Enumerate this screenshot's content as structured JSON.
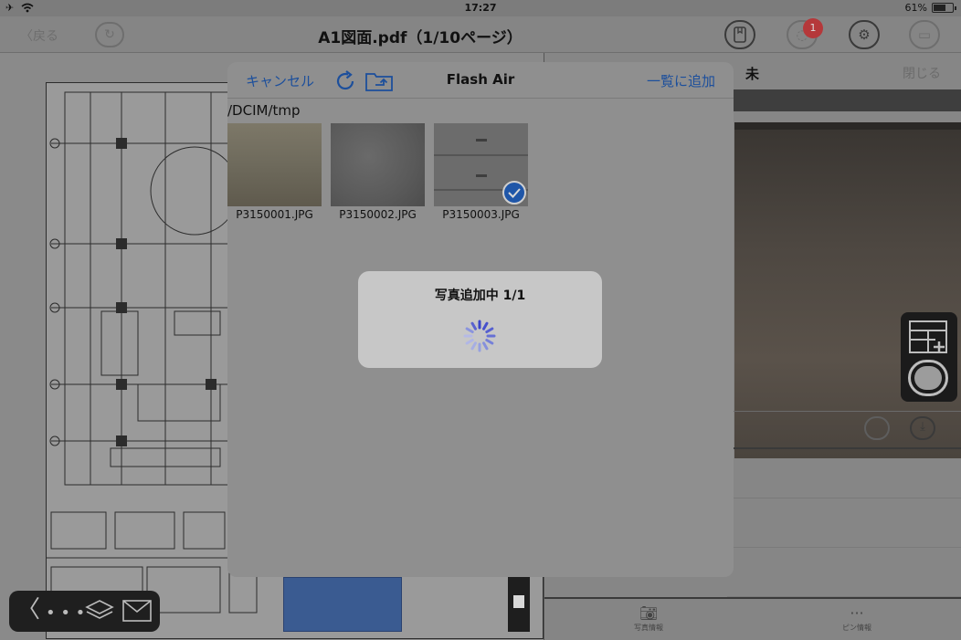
{
  "status_bar": {
    "time": "17:27",
    "battery": "61%"
  },
  "nav": {
    "back_label": "〈戻る",
    "title": "A1図面.pdf（1/10ページ）",
    "notification_count": "1"
  },
  "right_panel": {
    "title": "未",
    "close_label": "閉じる",
    "tabs": [
      {
        "label": "写真情報"
      },
      {
        "label": "ピン情報"
      }
    ]
  },
  "modal": {
    "cancel_label": "キャンセル",
    "title": "Flash Air",
    "add_label": "一覧に追加",
    "path": "/DCIM/tmp",
    "files": [
      {
        "name": "P3150001.JPG",
        "selected": false
      },
      {
        "name": "P3150002.JPG",
        "selected": false
      },
      {
        "name": "P3150003.JPG",
        "selected": true
      }
    ]
  },
  "progress_alert": {
    "title": "写真追加中 1/1"
  },
  "colors": {
    "accent": "#1c4f9c",
    "badge": "#b5383a",
    "overlay": "#8f8f8f"
  }
}
